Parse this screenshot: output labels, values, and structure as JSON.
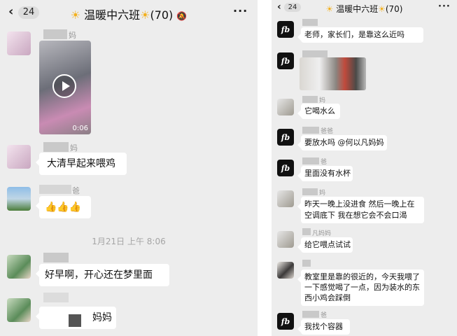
{
  "left": {
    "header": {
      "back_count": "24",
      "title": "温暖中六班",
      "member_count": "(70)"
    },
    "messages": {
      "m1_name": "妈",
      "video_duration": "0:06",
      "m2_name": "妈",
      "m2_text": "大清早起来喂鸡",
      "m3_name": "爸",
      "m3_text": "👍👍👍",
      "timestamp": "1月21日 上午 8:06",
      "m4_text": "好早啊，开心还在梦里面",
      "m5_text": "妈妈"
    }
  },
  "right": {
    "header": {
      "back_count": "24",
      "title": "温暖中六班",
      "member_count": "(70)"
    },
    "messages": {
      "r1_text": "老师，家长们，是靠这么近吗",
      "r3_name": "妈",
      "r3_text": "它喝水么",
      "r4_name": "爸爸",
      "r4_text": "要放水吗 @何以凡妈妈",
      "r5_name": "爸",
      "r5_text": "里面没有水杯",
      "r6_name": "妈",
      "r6_text": "昨天一晚上没进食 然后一晚上在空调底下 我在想它会不会口渴",
      "r7_name": "凡妈妈",
      "r7_text": "给它喂点试试",
      "r8_text": "教室里是靠的很近的，今天我喂了一下感觉喝了一点，因为装水的东西小鸡会踩倒",
      "r9_name": "爸",
      "r9_text": "我找个容器"
    }
  },
  "colors": {
    "accent_sun": "#f3b01c",
    "chat_bg": "#ededed",
    "bubble": "#ffffff"
  },
  "icons": [
    "chevron-left-icon",
    "sun-icon",
    "mute-bell-icon",
    "more-icon",
    "play-icon"
  ]
}
